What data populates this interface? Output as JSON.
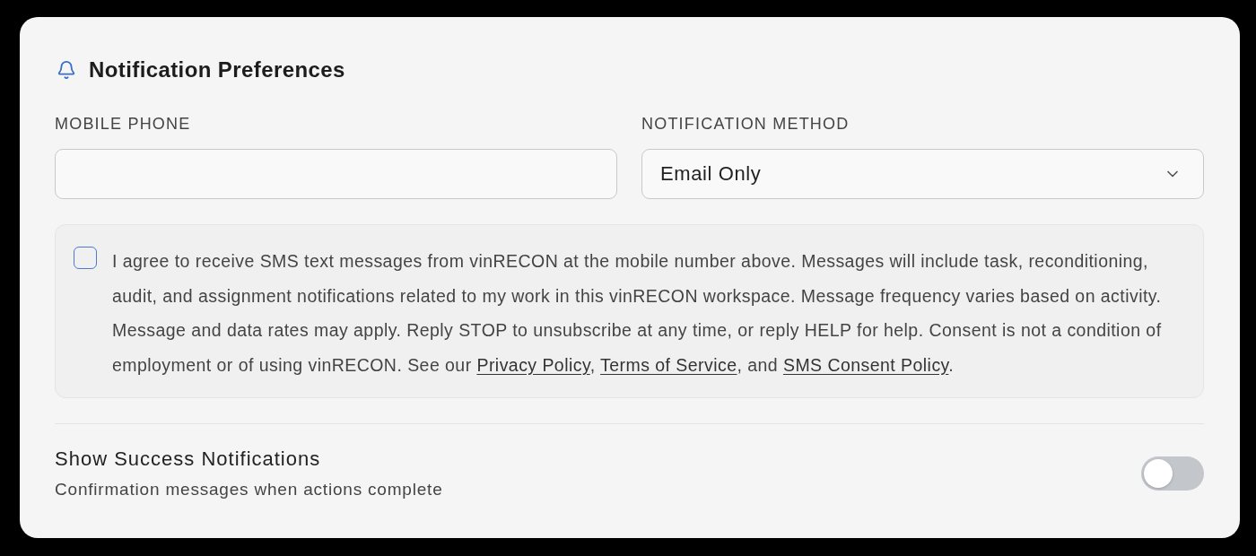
{
  "header": {
    "title": "Notification Preferences"
  },
  "fields": [
    {
      "kind": "input",
      "label": "MOBILE PHONE"
    },
    {
      "kind": "select",
      "label": "NOTIFICATION METHOD",
      "value": "Email Only"
    }
  ],
  "consent": {
    "checked": false,
    "segments": [
      {
        "kind": "text",
        "text": "I agree to receive SMS text messages from vinRECON at the mobile number above. Messages will include task, reconditioning, audit, and assignment notifications related to my work in this vinRECON workspace. Message frequency varies based on activity. Message and data rates may apply. Reply STOP to unsubscribe at any time, or reply HELP for help. Consent is not a condition of employment or of using vinRECON. See our "
      },
      {
        "kind": "link",
        "text": "Privacy Policy"
      },
      {
        "kind": "text",
        "text": ", "
      },
      {
        "kind": "link",
        "text": "Terms of Service"
      },
      {
        "kind": "text",
        "text": ", and "
      },
      {
        "kind": "link",
        "text": "SMS Consent Policy"
      },
      {
        "kind": "text",
        "text": "."
      }
    ]
  },
  "settings": [
    {
      "title": "Show Success Notifications",
      "description": "Confirmation messages when actions complete",
      "on": false
    }
  ]
}
